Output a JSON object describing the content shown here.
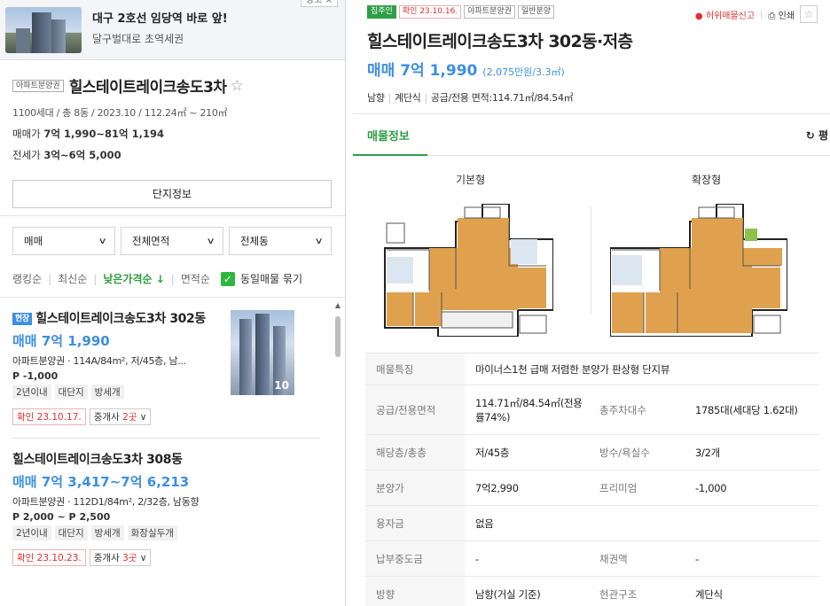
{
  "ad": {
    "title": "대구 2호선 임당역 바로 앞!",
    "subtitle": "달구벌대로 초역세권"
  },
  "complex": {
    "type_tag": "아파트분양권",
    "name": "힐스테이트레이크송도3차",
    "info": "1100세대 / 총 8동 / 2023.10 / 112.24㎡ ~ 210㎡",
    "sale_label": "매매가",
    "sale_value": "7억 1,990~81억 1,194",
    "jeonse_label": "전세가",
    "jeonse_value": "3억~6억 5,000",
    "detail_button": "단지정보"
  },
  "filters": {
    "trade": "매매",
    "area": "전체면적",
    "dong": "전체동"
  },
  "sorts": {
    "items": [
      "랭킹순",
      "최신순",
      "낮은가격순 ↓",
      "면적순"
    ],
    "group_label": "동일매물 묶기"
  },
  "listings": [
    {
      "tag": "현장",
      "title": "힐스테이트레이크송도3차 302동",
      "price": "매매 7억 1,990",
      "desc": "아파트분양권 · 114A/84m², 저/45층, 남...",
      "premium": "P -1,000",
      "badges": [
        "2년이내",
        "대단지",
        "방세개"
      ],
      "confirm": "확인 23.10.17.",
      "agent_prefix": "중개사 ",
      "agent_count": "2곳",
      "photo_count": "10"
    },
    {
      "title": "힐스테이트레이크송도3차 308동",
      "price": "매매 7억 3,417~7억 6,213",
      "desc": "아파트분양권 · 112D1/84m², 2/32층, 남동향",
      "premium": "P 2,000 ~ P 2,500",
      "badges": [
        "2년이내",
        "대단지",
        "방세개",
        "화장실두개"
      ],
      "confirm": "확인 23.10.23.",
      "agent_prefix": "중개사 ",
      "agent_count": "3곳"
    }
  ],
  "detail": {
    "tags": [
      "집주인",
      "확인 23.10.16.",
      "아파트분양권",
      "일반분양"
    ],
    "report": "허위매물신고",
    "print": "인쇄",
    "title": "힐스테이트레이크송도3차 302동·저층",
    "price": "매매 7억 1,990",
    "price_sub": "(2,075만원/3.3㎡)",
    "spec_direction": "남향",
    "spec_structure": "계단식",
    "spec_area": "공급/전용 면적:114.71㎡/84.54㎡",
    "tab": "매물정보",
    "pyeong": "평",
    "plan_basic": "기본형",
    "plan_ext": "확장형"
  },
  "table": {
    "feature_key": "매물특징",
    "feature_val": "마이너스1천 급매 저렴한 분양가 판상형 단지뷰",
    "rows": [
      {
        "k1": "공급/전용면적",
        "v1": "114.71㎡/84.54㎡(전용률74%)",
        "k2": "총주차대수",
        "v2": "1785대(세대당 1.62대)"
      },
      {
        "k1": "해당층/총층",
        "v1": "저/45층",
        "k2": "방수/욕실수",
        "v2": "3/2개"
      },
      {
        "k1": "분양가",
        "v1": "7억2,990",
        "k2": "프리미엄",
        "v2": "-1,000"
      },
      {
        "k1": "융자금",
        "v1": "없음",
        "k2": "",
        "v2": ""
      },
      {
        "k1": "납부중도금",
        "v1": "-",
        "k2": "채권액",
        "v2": "-"
      },
      {
        "k1": "방향",
        "v1": "남향(거실 기준)",
        "k2": "현관구조",
        "v2": "계단식"
      }
    ]
  },
  "colors": {
    "accent_green": "#2e9e47",
    "price_blue": "#3d8ee0",
    "confirm_red": "#e03030"
  }
}
